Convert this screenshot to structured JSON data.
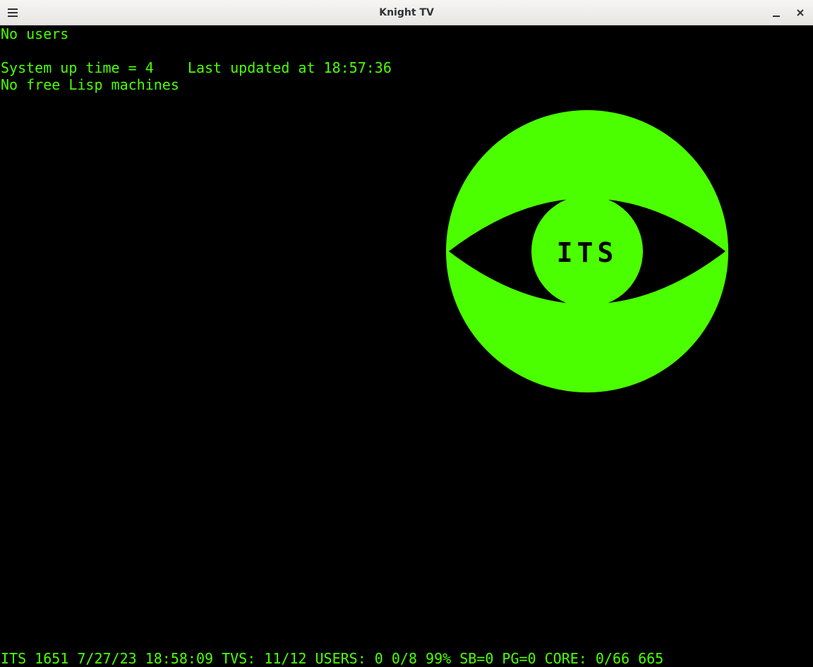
{
  "window": {
    "title": "Knight TV",
    "menu_icon": "hamburger-menu-icon",
    "minimize_icon": "minimize-icon",
    "close_icon": "close-icon"
  },
  "terminal": {
    "lines": [
      "No users",
      "",
      "System up time = 4    Last updated at 18:57:36",
      "No free Lisp machines"
    ],
    "status_line": "ITS 1651 7/27/23 18:58:09 TVS: 11/12 USERS: 0 0/8 99% SB=0 PG=0 CORE: 0/66 665",
    "logo_text": "ITS",
    "colors": {
      "foreground": "#4cff00",
      "background": "#000000"
    }
  }
}
